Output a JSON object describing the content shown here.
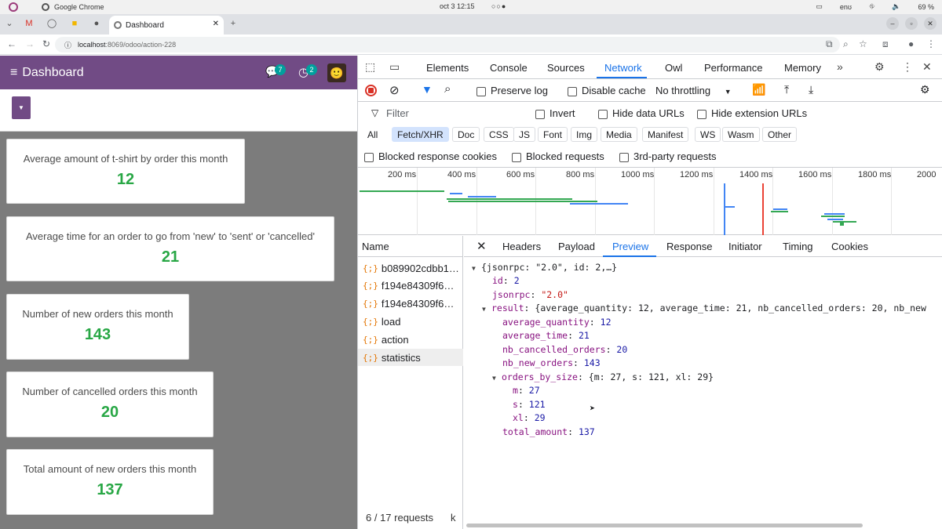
{
  "system": {
    "app_name": "Google Chrome",
    "clock": "oct 3  12:15",
    "lang": "enʊ",
    "battery": "69 %"
  },
  "browser": {
    "tab_title": "Dashboard",
    "url_host": "localhost",
    "url_path": ":8069/odoo/action-228"
  },
  "app": {
    "title": "Dashboard",
    "messages_badge": "7",
    "activities_badge": "2",
    "cards": [
      {
        "label": "Average amount of t-shirt by order this month",
        "value": "12"
      },
      {
        "label": "Average time for an order to go from 'new' to 'sent' or 'cancelled'",
        "value": "21"
      },
      {
        "label": "Number of new orders this month",
        "value": "143"
      },
      {
        "label": "Number of cancelled orders this month",
        "value": "20"
      },
      {
        "label": "Total amount of new orders this month",
        "value": "137"
      }
    ]
  },
  "devtools": {
    "tabs": [
      "Elements",
      "Console",
      "Sources",
      "Network",
      "Owl",
      "Performance",
      "Memory"
    ],
    "active_tab": "Network",
    "toolbar": {
      "preserve_log": "Preserve log",
      "disable_cache": "Disable cache",
      "throttling": "No throttling"
    },
    "filter": {
      "placeholder": "Filter",
      "invert": "Invert",
      "hide_data_urls": "Hide data URLs",
      "hide_extension_urls": "Hide extension URLs"
    },
    "type_filters": [
      "All",
      "Fetch/XHR",
      "Doc",
      "CSS",
      "JS",
      "Font",
      "Img",
      "Media",
      "Manifest",
      "WS",
      "Wasm",
      "Other"
    ],
    "active_type_filter": "Fetch/XHR",
    "blocked": {
      "cookies": "Blocked response cookies",
      "requests": "Blocked requests",
      "third_party": "3rd-party requests"
    },
    "timeline_ticks": [
      "200 ms",
      "400 ms",
      "600 ms",
      "800 ms",
      "1000 ms",
      "1200 ms",
      "1400 ms",
      "1600 ms",
      "1800 ms",
      "2000"
    ],
    "name_header": "Name",
    "requests": [
      "b089902cdbb1…",
      "f194e84309f6…",
      "f194e84309f6…",
      "load",
      "action",
      "statistics"
    ],
    "selected_request": "statistics",
    "status": "6 / 17 requests",
    "status_tail": "k",
    "detail_tabs": [
      "Headers",
      "Payload",
      "Preview",
      "Response",
      "Initiator",
      "Timing",
      "Cookies"
    ],
    "active_detail_tab": "Preview",
    "preview": {
      "root": "{jsonrpc: \"2.0\", id: 2,…}",
      "id_key": "id",
      "id_val": "2",
      "jsonrpc_key": "jsonrpc",
      "jsonrpc_val": "\"2.0\"",
      "result_key": "result",
      "result_summary": "{average_quantity: 12, average_time: 21, nb_cancelled_orders: 20, nb_new",
      "fields": [
        {
          "key": "average_quantity",
          "val": "12"
        },
        {
          "key": "average_time",
          "val": "21"
        },
        {
          "key": "nb_cancelled_orders",
          "val": "20"
        },
        {
          "key": "nb_new_orders",
          "val": "143"
        }
      ],
      "obs_key": "orders_by_size",
      "obs_summary": "{m: 27, s: 121, xl: 29}",
      "sizes": [
        {
          "key": "m",
          "val": "27"
        },
        {
          "key": "s",
          "val": "121"
        },
        {
          "key": "xl",
          "val": "29"
        }
      ],
      "total_key": "total_amount",
      "total_val": "137"
    }
  }
}
